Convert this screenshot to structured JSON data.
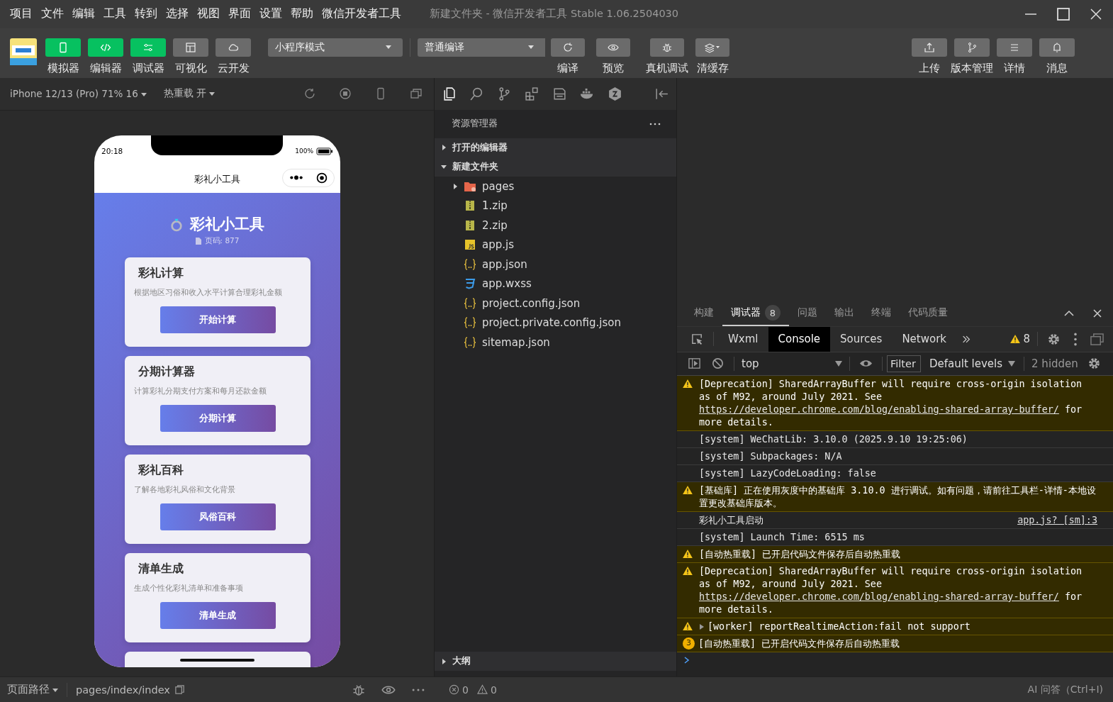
{
  "window": {
    "menu": [
      "项目",
      "文件",
      "编辑",
      "工具",
      "转到",
      "选择",
      "视图",
      "界面",
      "设置",
      "帮助",
      "微信开发者工具"
    ],
    "title": "新建文件夹 - 微信开发者工具 Stable 1.06.2504030"
  },
  "toolbar": {
    "views": [
      {
        "label": "模拟器",
        "on": true
      },
      {
        "label": "编辑器",
        "on": true
      },
      {
        "label": "调试器",
        "on": true
      },
      {
        "label": "可视化",
        "on": false
      },
      {
        "label": "云开发",
        "on": false
      }
    ],
    "mode": "小程序模式",
    "compile": "普通编译",
    "actions": [
      {
        "label": "编译"
      },
      {
        "label": "预览"
      },
      {
        "label": "真机调试"
      },
      {
        "label": "清缓存"
      }
    ],
    "right": [
      {
        "label": "上传"
      },
      {
        "label": "版本管理"
      },
      {
        "label": "详情"
      },
      {
        "label": "消息"
      }
    ]
  },
  "simulator": {
    "device": "iPhone 12/13 (Pro) 71% 16",
    "hot_reload": "热重载 开",
    "phone": {
      "time": "20:18",
      "battery": "100%",
      "nav_title": "彩礼小工具",
      "header_title": "彩礼小工具",
      "page_count": "页码: 877",
      "cards": [
        {
          "title": "彩礼计算",
          "description": "根据地区习俗和收入水平计算合理彩礼金额",
          "button": "开始计算"
        },
        {
          "title": "分期计算器",
          "description": "计算彩礼分期支付方案和每月还款金额",
          "button": "分期计算"
        },
        {
          "title": "彩礼百科",
          "description": "了解各地彩礼风俗和文化背景",
          "button": "风俗百科"
        },
        {
          "title": "清单生成",
          "description": "生成个性化彩礼清单和准备事项",
          "button": "清单生成"
        }
      ]
    },
    "status": {
      "path_label": "页面路径",
      "path": "pages/index/index"
    }
  },
  "explorer": {
    "title": "资源管理器",
    "sections": [
      {
        "label": "打开的编辑器",
        "expanded": false
      },
      {
        "label": "新建文件夹",
        "expanded": true,
        "children": [
          {
            "name": "pages",
            "kind": "folder",
            "expanded": false
          },
          {
            "name": "1.zip",
            "kind": "zip"
          },
          {
            "name": "2.zip",
            "kind": "zip"
          },
          {
            "name": "app.js",
            "kind": "js"
          },
          {
            "name": "app.json",
            "kind": "json"
          },
          {
            "name": "app.wxss",
            "kind": "wxss"
          },
          {
            "name": "project.config.json",
            "kind": "json"
          },
          {
            "name": "project.private.config.json",
            "kind": "json"
          },
          {
            "name": "sitemap.json",
            "kind": "json"
          }
        ]
      }
    ],
    "outline": {
      "label": "大纲",
      "expanded": false
    },
    "errors": "0",
    "warnings": "0"
  },
  "devtools": {
    "tabs": [
      {
        "label": "构建",
        "selected": false
      },
      {
        "label": "调试器",
        "selected": true,
        "badge": "8"
      },
      {
        "label": "问题",
        "selected": false
      },
      {
        "label": "输出",
        "selected": false
      },
      {
        "label": "终端",
        "selected": false
      },
      {
        "label": "代码质量",
        "selected": false
      }
    ],
    "panels": [
      {
        "label": "Wxml",
        "selected": false
      },
      {
        "label": "Console",
        "selected": true
      },
      {
        "label": "Sources",
        "selected": false
      },
      {
        "label": "Network",
        "selected": false
      }
    ],
    "warning_count": "8",
    "context": "top",
    "filter_placeholder": "Filter",
    "levels": "Default levels",
    "hidden": "2 hidden",
    "messages": [
      {
        "kind": "warning",
        "text": "[Deprecation] SharedArrayBuffer will require cross-origin isolation as of M92, around July 2021. See ",
        "link": "https://developer.chrome.com/blog/enabling-shared-array-buffer/",
        "after": " for more details."
      },
      {
        "kind": "log",
        "text": "[system] WeChatLib: 3.10.0 (2025.9.10 19:25:06)"
      },
      {
        "kind": "log",
        "text": "[system] Subpackages: N/A"
      },
      {
        "kind": "log",
        "text": "[system] LazyCodeLoading: false"
      },
      {
        "kind": "warning",
        "text": "[基础库] 正在使用灰度中的基础库 3.10.0 进行调试。如有问题，请前往工具栏-详情-本地设置更改基础库版本。"
      },
      {
        "kind": "log",
        "text": "彩礼小工具启动",
        "source": "app.js? [sm]:3"
      },
      {
        "kind": "log",
        "text": "[system] Launch Time: 6515 ms"
      },
      {
        "kind": "warning",
        "text": "[自动热重载] 已开启代码文件保存后自动热重载"
      },
      {
        "kind": "warning",
        "text": "[Deprecation] SharedArrayBuffer will require cross-origin isolation as of M92, around July 2021. See ",
        "link": "https://developer.chrome.com/blog/enabling-shared-array-buffer/",
        "after": " for more details."
      },
      {
        "kind": "warning",
        "text": "[worker] reportRealtimeAction:fail not support",
        "expanded": false
      },
      {
        "kind": "warning",
        "text": "[自动热重载] 已开启代码文件保存后自动热重载",
        "count": "3"
      }
    ]
  },
  "status_bar": {
    "ai": "AI 问答（Ctrl+I)"
  }
}
